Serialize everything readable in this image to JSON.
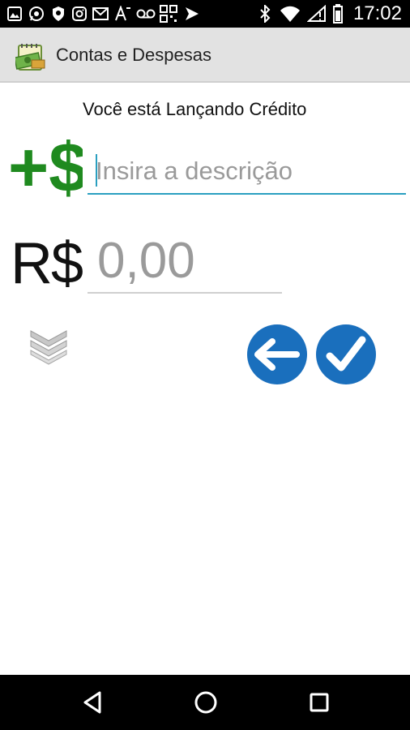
{
  "status_bar": {
    "time": "17:02",
    "icons": [
      "image-icon",
      "whatsapp-icon",
      "shield-icon",
      "instagram-icon",
      "gmail-icon",
      "font-icon",
      "voicemail-icon",
      "qr-icon",
      "delivery-icon",
      "bluetooth-icon",
      "wifi-icon",
      "no-sim-icon",
      "battery-icon"
    ]
  },
  "app_bar": {
    "title": "Contas e Despesas",
    "logo_icon": "money-notebook-icon"
  },
  "main": {
    "mode_text": "Você está Lançando Crédito",
    "credit_icon_text": "+$",
    "description_placeholder": "Insira a descrição",
    "currency_label": "R$",
    "value_placeholder": "0,00",
    "expand_icon": "chevrons-down-icon",
    "back_icon": "arrow-left-icon",
    "confirm_icon": "checkmark-icon"
  },
  "colors": {
    "accent": "#1a6fbd",
    "credit_green": "#1f8a1f",
    "input_underline": "#2a9fc0",
    "appbar_bg": "#e2e2e2"
  },
  "nav_bar": {
    "icons": [
      "back-triangle-icon",
      "home-circle-icon",
      "recents-square-icon"
    ]
  }
}
